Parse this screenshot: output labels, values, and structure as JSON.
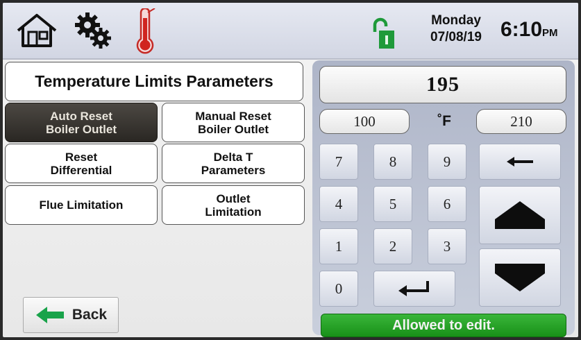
{
  "header": {
    "icons": [
      "home-icon",
      "gear-icon",
      "thermometer-icon",
      "lock-open-icon"
    ],
    "day": "Monday",
    "date": "07/08/19",
    "time": "6:10",
    "ampm": "PM"
  },
  "page_title": "Temperature Limits Parameters",
  "param_buttons": {
    "auto_reset_line1": "Auto Reset",
    "auto_reset_line2": "Boiler Outlet",
    "manual_reset_line1": "Manual Reset",
    "manual_reset_line2": "Boiler Outlet",
    "reset_diff_line1": "Reset",
    "reset_diff_line2": "Differential",
    "delta_t_line1": "Delta T",
    "delta_t_line2": "Parameters",
    "flue": "Flue Limitation",
    "outlet_line1": "Outlet",
    "outlet_line2": "Limitation"
  },
  "back_label": "Back",
  "keypad": {
    "value": "195",
    "min": "100",
    "max": "210",
    "unit": "˚F",
    "keys": [
      "7",
      "8",
      "9",
      "4",
      "5",
      "6",
      "1",
      "2",
      "3",
      "0"
    ],
    "status": "Allowed to edit."
  },
  "colors": {
    "active_button": "#2f2c28",
    "status_green": "#22a022",
    "back_arrow_green": "#19a34a",
    "thermometer_red": "#d0241f",
    "lock_green": "#1f9a3a"
  }
}
